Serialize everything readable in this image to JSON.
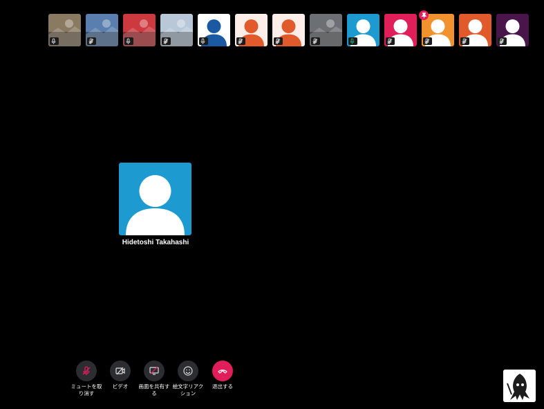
{
  "participants": [
    {
      "kind": "photo",
      "bg": "#8a7a62",
      "icon": "mic-icon"
    },
    {
      "kind": "photo",
      "bg": "#5a7fae",
      "icon": "mic-off-icon"
    },
    {
      "kind": "photo",
      "bg": "#cc3a3f",
      "icon": "mic-icon"
    },
    {
      "kind": "photo",
      "bg": "#b9c8d9",
      "icon": "mic-off-icon"
    },
    {
      "kind": "avatar",
      "bg": "#ffffff",
      "fg": "#1b5aa3",
      "icon": "mic-icon"
    },
    {
      "kind": "avatar",
      "bg": "#fdeeea",
      "fg": "#e05a2b",
      "icon": "mic-off-icon"
    },
    {
      "kind": "avatar",
      "bg": "#fdeeea",
      "fg": "#e05a2b",
      "icon": "mic-off-icon"
    },
    {
      "kind": "photo",
      "bg": "#6c6f74",
      "icon": "mic-off-icon"
    },
    {
      "kind": "avatar",
      "bg": "#1d9bd1",
      "fg": "#ffffff",
      "icon": "mic-active-icon",
      "pinned": true
    },
    {
      "kind": "avatar",
      "bg": "#e01e5a",
      "fg": "#ffffff",
      "icon": "mic-off-icon"
    },
    {
      "kind": "avatar",
      "bg": "#f2922e",
      "fg": "#ffffff",
      "icon": "mic-off-icon"
    },
    {
      "kind": "avatar",
      "bg": "#e05a2b",
      "fg": "#ffffff",
      "icon": "mic-off-icon"
    },
    {
      "kind": "avatar",
      "bg": "#4a154b",
      "fg": "#ffffff",
      "icon": "mic-off-icon"
    }
  ],
  "main_speaker": {
    "name": "Hidetoshi Takahashi",
    "bg": "#1d9bd1",
    "fg": "#ffffff"
  },
  "controls": {
    "unmute_label": "ミュートを取り消す",
    "video_label": "ビデオ",
    "share_label": "画面を共有する",
    "reaction_label": "絵文字リアクション",
    "leave_label": "退出する"
  },
  "colors": {
    "leave": "#e01e5a",
    "control_bg": "#2c2d30",
    "muted": "#e01e5a"
  }
}
